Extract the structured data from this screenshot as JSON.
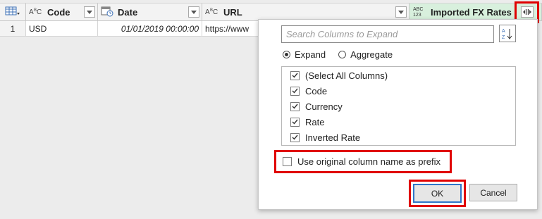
{
  "header": {
    "columns": [
      {
        "type_icon": "ABC",
        "title": "Code"
      },
      {
        "type_icon": "calendar-clock",
        "title": "Date"
      },
      {
        "type_icon": "ABC",
        "title": "URL"
      },
      {
        "type_icon": "ABC 123",
        "title": "Imported FX Rates"
      }
    ]
  },
  "row": {
    "index": "1",
    "code": "USD",
    "date": "01/01/2019 00:00:00",
    "url": "https://www"
  },
  "popup": {
    "search_placeholder": "Search Columns to Expand",
    "radio_expand": "Expand",
    "radio_aggregate": "Aggregate",
    "selected_mode": "Expand",
    "columns": [
      {
        "label": "(Select All Columns)",
        "checked": true
      },
      {
        "label": "Code",
        "checked": true
      },
      {
        "label": "Currency",
        "checked": true
      },
      {
        "label": "Rate",
        "checked": true
      },
      {
        "label": "Inverted Rate",
        "checked": true
      }
    ],
    "prefix_label": "Use original column name as prefix",
    "prefix_checked": false,
    "ok_label": "OK",
    "cancel_label": "Cancel"
  },
  "colors": {
    "highlight": "#e00000",
    "ok_border": "#2f75c9",
    "fx_header_bg": "#d8f0dd"
  }
}
